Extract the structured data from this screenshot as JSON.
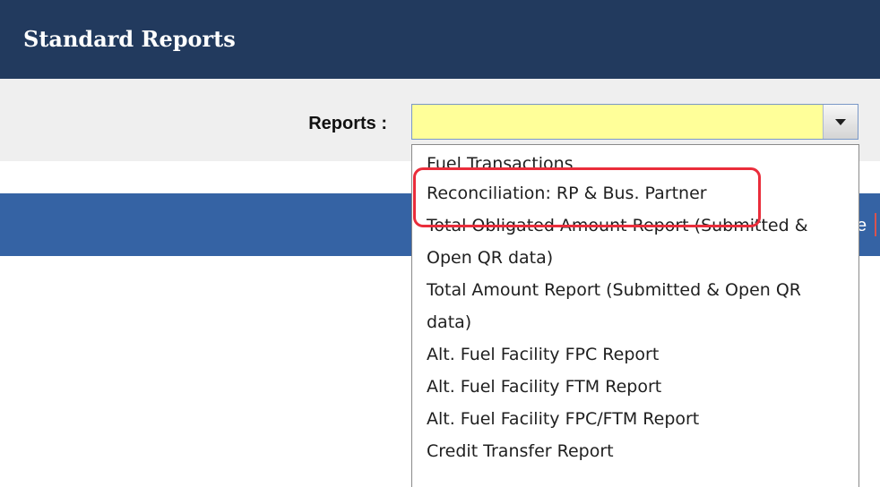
{
  "header": {
    "title": "Standard Reports",
    "background": "#223a5e"
  },
  "filter": {
    "label": "Reports :",
    "select_value": "",
    "select_background": "#ffff99",
    "arrow_icon": "caret-down-icon"
  },
  "band": {
    "fragment_text": "e",
    "background": "#3563a4"
  },
  "dropdown": {
    "items": [
      "Fuel Transactions",
      "Reconciliation: RP & Bus. Partner",
      "Total Obligated Amount Report (Submitted & Open QR data)",
      "Total Amount Report (Submitted & Open QR data)",
      "Alt. Fuel Facility FPC Report",
      "Alt. Fuel Facility FTM Report",
      "Alt. Fuel Facility FPC/FTM Report",
      "Credit Transfer Report"
    ],
    "highlighted_item": "Reconciliation: RP & Bus. Partner",
    "highlight_color": "#ea2d3b"
  }
}
